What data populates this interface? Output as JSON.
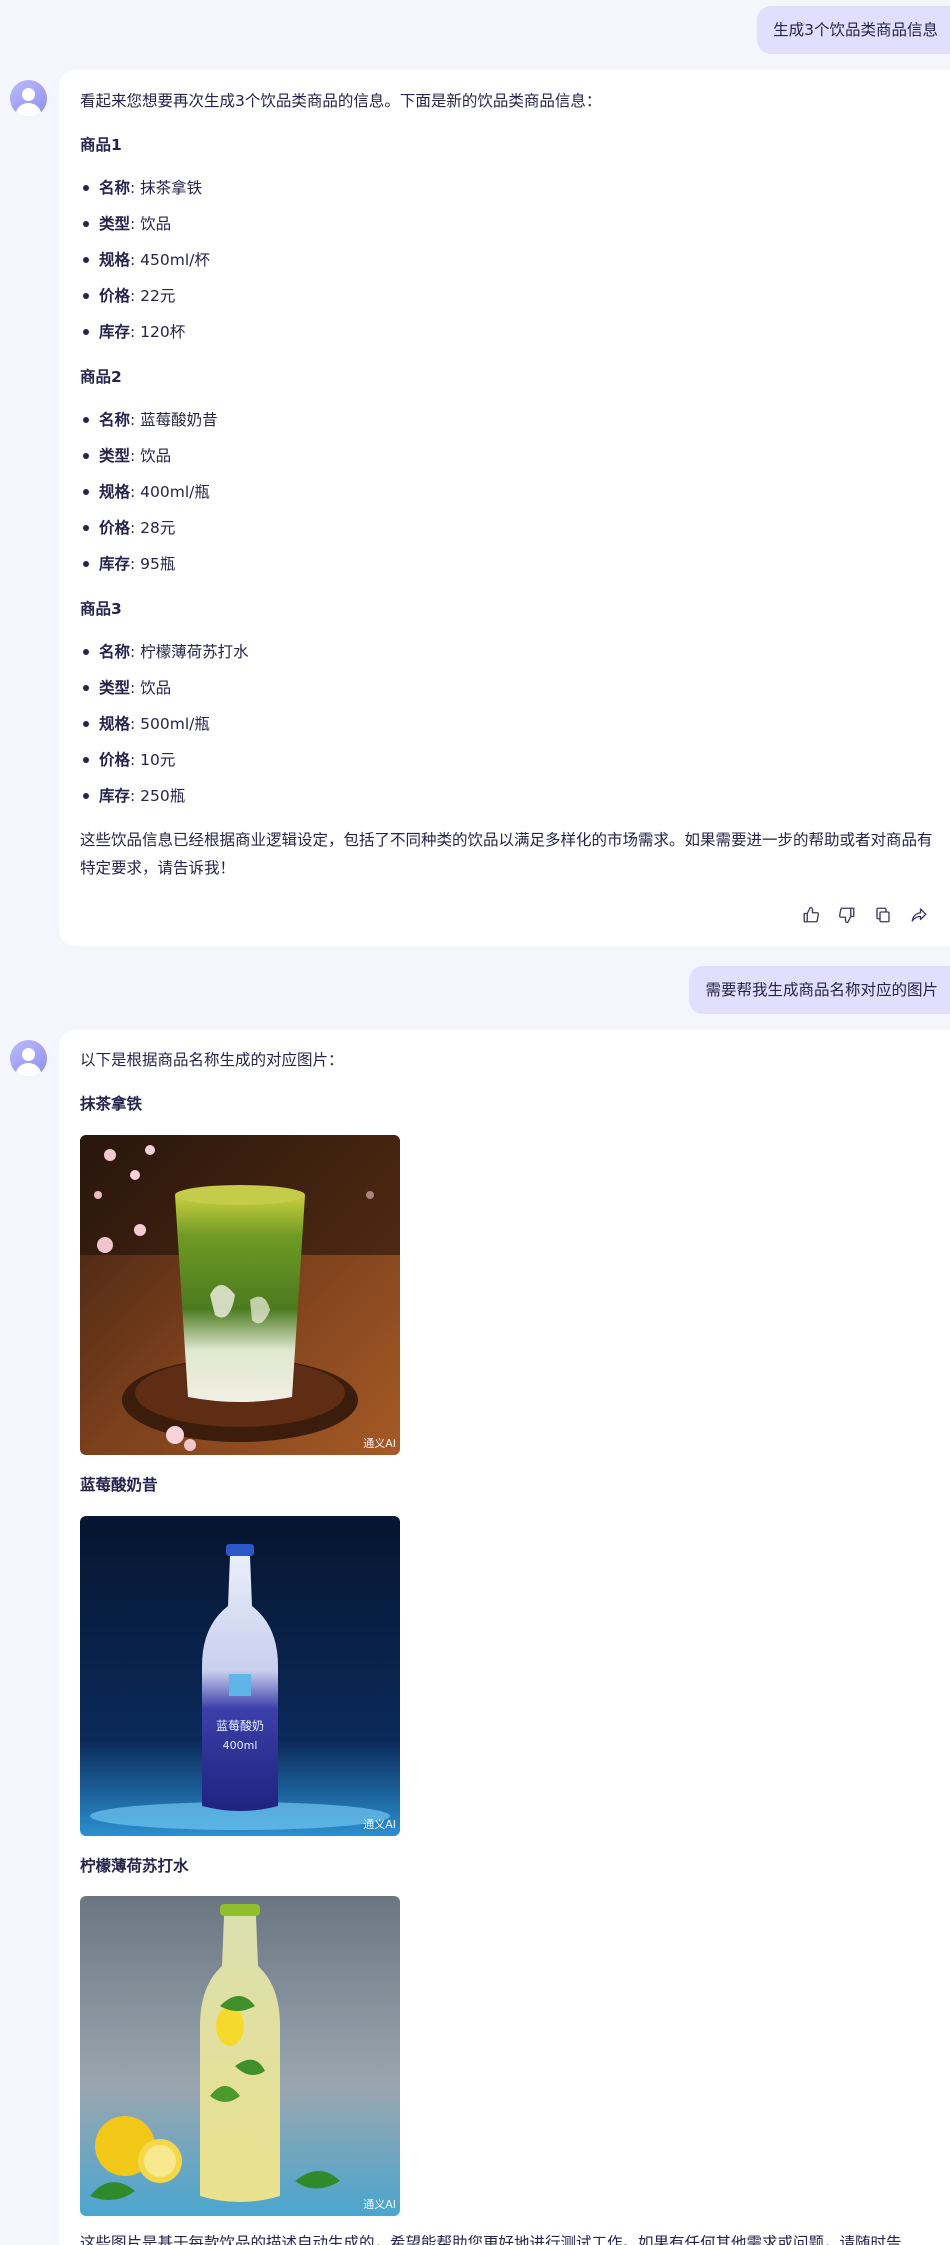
{
  "conversation": {
    "user_message_1": "生成3个饮品类商品信息",
    "bot_response_1": {
      "intro": "看起来您想要再次生成3个饮品类商品的信息。下面是新的饮品类商品信息：",
      "products": [
        {
          "heading": "商品1",
          "fields": [
            {
              "label": "名称",
              "value": ": 抹茶拿铁"
            },
            {
              "label": "类型",
              "value": ": 饮品"
            },
            {
              "label": "规格",
              "value": ": 450ml/杯"
            },
            {
              "label": "价格",
              "value": ": 22元"
            },
            {
              "label": "库存",
              "value": ": 120杯"
            }
          ]
        },
        {
          "heading": "商品2",
          "fields": [
            {
              "label": "名称",
              "value": ": 蓝莓酸奶昔"
            },
            {
              "label": "类型",
              "value": ": 饮品"
            },
            {
              "label": "规格",
              "value": ": 400ml/瓶"
            },
            {
              "label": "价格",
              "value": ": 28元"
            },
            {
              "label": "库存",
              "value": ": 95瓶"
            }
          ]
        },
        {
          "heading": "商品3",
          "fields": [
            {
              "label": "名称",
              "value": ": 柠檬薄荷苏打水"
            },
            {
              "label": "类型",
              "value": ": 饮品"
            },
            {
              "label": "规格",
              "value": ": 500ml/瓶"
            },
            {
              "label": "价格",
              "value": ": 10元"
            },
            {
              "label": "库存",
              "value": ": 250瓶"
            }
          ]
        }
      ],
      "closing": "这些饮品信息已经根据商业逻辑设定，包括了不同种类的饮品以满足多样化的市场需求。如果需要进一步的帮助或者对商品有特定要求，请告诉我！"
    },
    "user_message_2": "需要帮我生成商品名称对应的图片",
    "bot_response_2": {
      "intro": "以下是根据商品名称生成的对应图片：",
      "images": [
        {
          "caption": "抹茶拿铁",
          "watermark": "通义AI"
        },
        {
          "caption": "蓝莓酸奶昔",
          "watermark": "通义AI",
          "bottle_label": "蓝莓酸奶",
          "bottle_volume": "400ml"
        },
        {
          "caption": "柠檬薄荷苏打水",
          "watermark": "通义AI"
        }
      ],
      "closing_partial": "这些图片是基于每款饮品的描述自动生成的，希望能帮助您更好地进行测试工作。如果有任何其他需求或问题，请随时告"
    }
  },
  "icons": {
    "actions": [
      "thumbs-up-icon",
      "thumbs-down-icon",
      "copy-icon",
      "share-icon"
    ],
    "avatar": "bot-avatar"
  },
  "colors": {
    "page_bg": "#f5f6fb",
    "user_bubble": "#e2defd",
    "card_bg": "#ffffff",
    "text": "#26244c",
    "avatar": "#9d9cf4"
  }
}
